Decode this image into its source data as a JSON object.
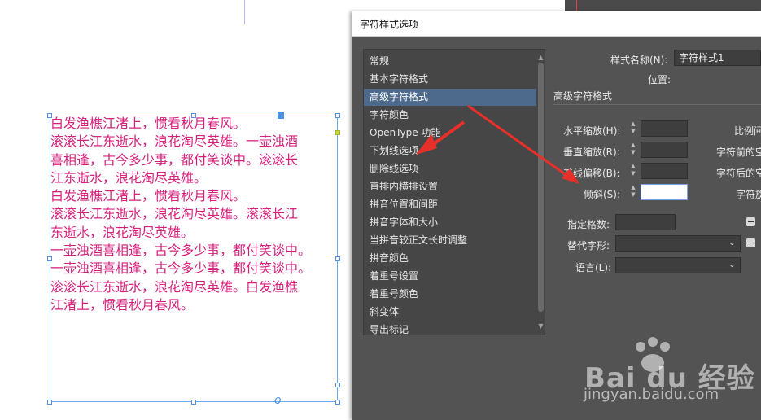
{
  "dialog": {
    "title": "字符样式选项",
    "nav_items": [
      "常规",
      "基本字符格式",
      "高级字符格式",
      "字符颜色",
      "OpenType 功能",
      "下划线选项",
      "删除线选项",
      "直排内横排设置",
      "拼音位置和间距",
      "拼音字体和大小",
      "当拼音较正文长时调整",
      "拼音颜色",
      "着重号设置",
      "着重号颜色",
      "斜变体",
      "导出标记"
    ],
    "selected_index": 2,
    "style_name_label": "样式名称(N):",
    "style_name_value": "字符样式1",
    "position_label": "位置:",
    "section_title": "高级字符格式",
    "fields": {
      "horizontal_scale_label": "水平缩放(H):",
      "vertical_scale_label": "垂直缩放(R):",
      "baseline_shift_label": "基线偏移(B):",
      "skew_label": "倾斜(S):",
      "horizontal_scale_value": "",
      "vertical_scale_value": "",
      "baseline_shift_value": "",
      "skew_value": ""
    },
    "right_labels": [
      "比例间",
      "字符前的空",
      "字符后的空",
      "字符旋"
    ],
    "specify_grid_label": "指定格数:",
    "alternate_glyph_label": "替代字形:",
    "language_label": "语言(L):"
  },
  "document": {
    "text_lines": [
      "白发渔樵江渚上，惯看秋月春风。",
      "滚滚长江东逝水，浪花淘尽英雄。一壶浊酒",
      "喜相逢，古今多少事，都付笑谈中。滚滚长",
      "江东逝水，浪花淘尽英雄。",
      "白发渔樵江渚上，惯看秋月春风。",
      "滚滚长江东逝水，浪花淘尽英雄。滚滚长江",
      "东逝水，浪花淘尽英雄。",
      "一壶浊酒喜相逢，古今多少事，都付笑谈中。",
      "一壶浊酒喜相逢，古今多少事，都付笑谈中。",
      "滚滚长江东逝水，浪花淘尽英雄。白发渔樵",
      "江渚上，惯看秋月春风。"
    ],
    "overset_marker": "o",
    "text_color": "#d6207c"
  },
  "watermark": {
    "brand": "Bai du 经验",
    "url": "jingyan.baidu.com"
  }
}
